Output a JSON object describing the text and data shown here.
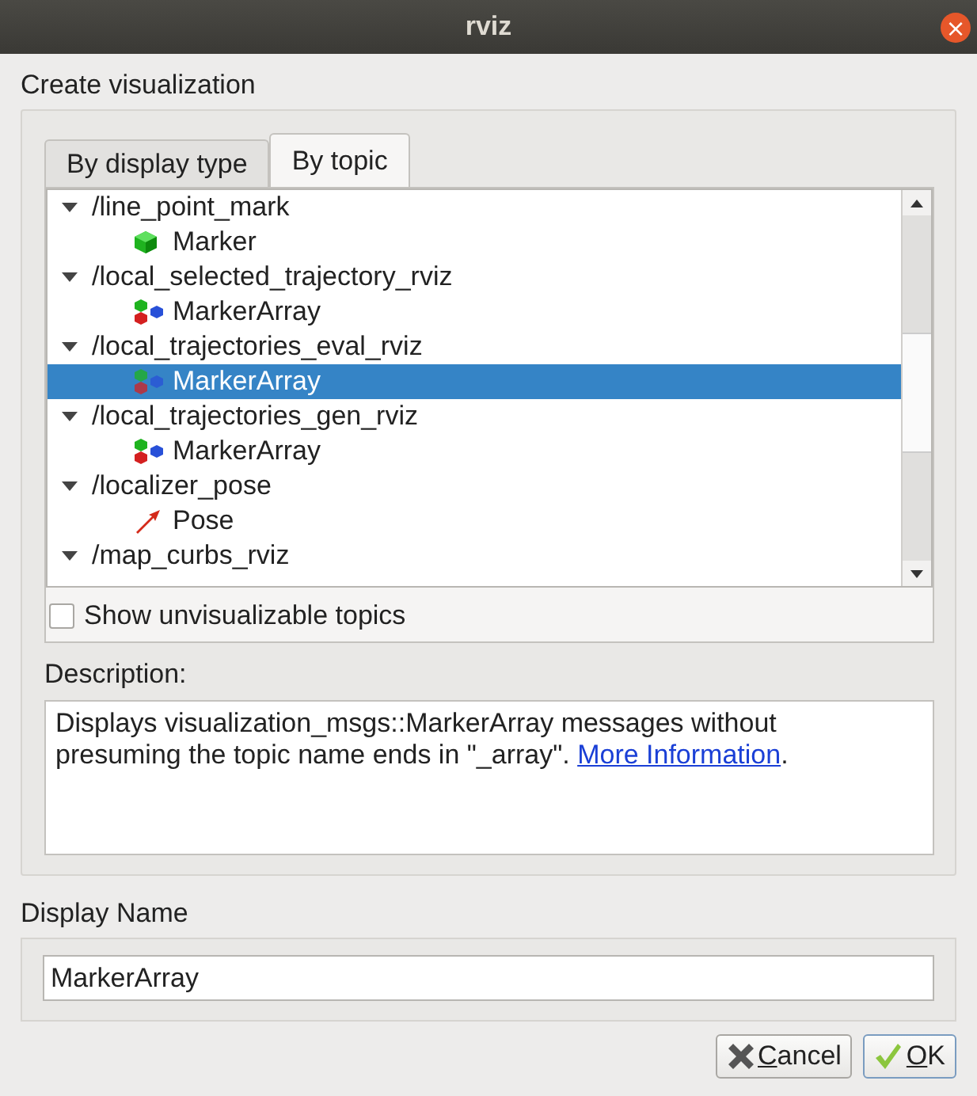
{
  "window": {
    "title": "rviz",
    "close": "×"
  },
  "section_title": "Create visualization",
  "tabs": [
    {
      "label": "By display type",
      "selected": false
    },
    {
      "label": "By topic",
      "selected": true
    }
  ],
  "topics": [
    {
      "label": "/line_point_mark",
      "expanded": true,
      "children": [
        {
          "label": "Marker",
          "kind": "marker",
          "selected": false
        }
      ]
    },
    {
      "label": "/local_selected_trajectory_rviz",
      "expanded": true,
      "children": [
        {
          "label": "MarkerArray",
          "kind": "marker_array",
          "selected": false
        }
      ]
    },
    {
      "label": "/local_trajectories_eval_rviz",
      "expanded": true,
      "children": [
        {
          "label": "MarkerArray",
          "kind": "marker_array",
          "selected": true
        }
      ]
    },
    {
      "label": "/local_trajectories_gen_rviz",
      "expanded": true,
      "children": [
        {
          "label": "MarkerArray",
          "kind": "marker_array",
          "selected": false
        }
      ]
    },
    {
      "label": "/localizer_pose",
      "expanded": true,
      "children": [
        {
          "label": "Pose",
          "kind": "pose",
          "selected": false
        }
      ]
    },
    {
      "label": "/map_curbs_rviz",
      "expanded": true
    }
  ],
  "show_unvisualizable": {
    "label": "Show unvisualizable topics",
    "checked": false
  },
  "description": {
    "label": "Description:",
    "text": "Displays visualization_msgs::MarkerArray messages without presuming the topic name ends in \"_array\". ",
    "link": "More Information",
    "suffix": "."
  },
  "display_name": {
    "label": "Display Name",
    "value": "MarkerArray"
  },
  "buttons": [
    {
      "label": "Cancel",
      "kind": "cancel"
    },
    {
      "label": "OK",
      "kind": "ok"
    }
  ]
}
